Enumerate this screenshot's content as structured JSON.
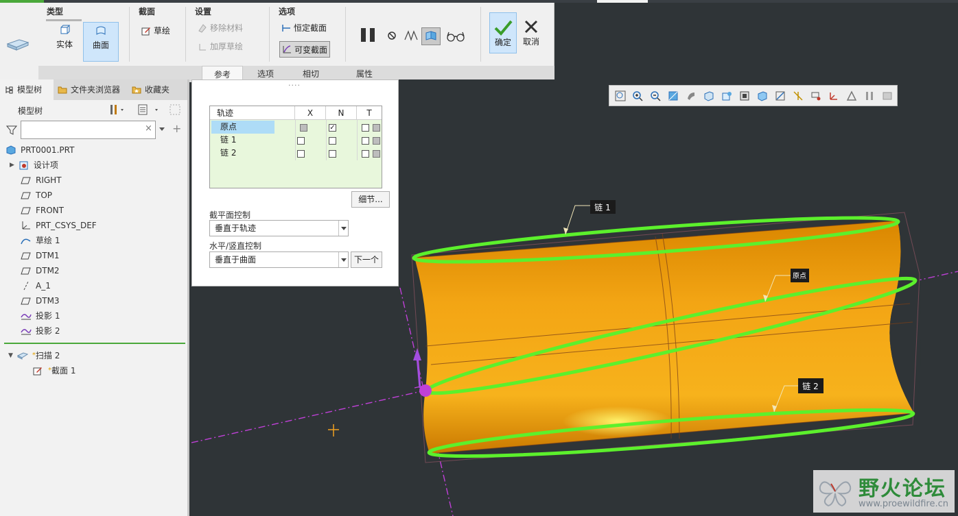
{
  "ribbon": {
    "groups": {
      "type": "类型",
      "section": "截面",
      "settings": "设置",
      "options": "选项"
    },
    "type_buttons": {
      "solid": "实体",
      "surface": "曲面"
    },
    "section_sketch": "草绘",
    "settings_items": {
      "remove_material": "移除材料",
      "thicken_sketch": "加厚草绘"
    },
    "options_items": {
      "constant_section": "恒定截面",
      "variable_section": "可变截面"
    },
    "confirm": "确定",
    "cancel": "取消",
    "tabs": [
      "参考",
      "选项",
      "相切",
      "属性"
    ]
  },
  "left_panel": {
    "tabs": [
      "模型树",
      "文件夹浏览器",
      "收藏夹"
    ],
    "tree_header": "模型树",
    "filter_placeholder": "",
    "items": [
      {
        "label": "PRT0001.PRT"
      },
      {
        "label": "设计项"
      },
      {
        "label": "RIGHT"
      },
      {
        "label": "TOP"
      },
      {
        "label": "FRONT"
      },
      {
        "label": "PRT_CSYS_DEF"
      },
      {
        "label": "草绘 1"
      },
      {
        "label": "DTM1"
      },
      {
        "label": "DTM2"
      },
      {
        "label": "A_1"
      },
      {
        "label": "DTM3"
      },
      {
        "label": "投影 1"
      },
      {
        "label": "投影 2"
      }
    ],
    "feature_items": [
      {
        "label": "扫描 2"
      },
      {
        "label": "截面 1"
      }
    ]
  },
  "references_panel": {
    "grip": "....",
    "table": {
      "headers": [
        "轨迹",
        "X",
        "N",
        "T"
      ],
      "rows": [
        {
          "name": "原点",
          "x": "gray",
          "n": "checked",
          "t": [
            "empty",
            "gray"
          ]
        },
        {
          "name": "链 1",
          "x": "empty",
          "n": "empty",
          "t": [
            "empty",
            "gray"
          ]
        },
        {
          "name": "链 2",
          "x": "empty",
          "n": "empty",
          "t": [
            "empty",
            "gray"
          ]
        }
      ]
    },
    "details_button": "细节...",
    "section_plane_label": "截平面控制",
    "section_plane_value": "垂直于轨迹",
    "horiz_vert_label": "水平/竖直控制",
    "horiz_vert_value": "垂直于曲面",
    "next_button": "下一个"
  },
  "viewport": {
    "labels": {
      "chain1": "链 1",
      "origin": "原点",
      "chain2": "链 2"
    },
    "colors": {
      "surface": "#f2a010",
      "trajectory": "#5cf02c",
      "datum": "#c040d8",
      "background": "#2f3437"
    }
  },
  "watermark": {
    "title": "野火论坛",
    "url": "www.proewildfire.cn"
  }
}
